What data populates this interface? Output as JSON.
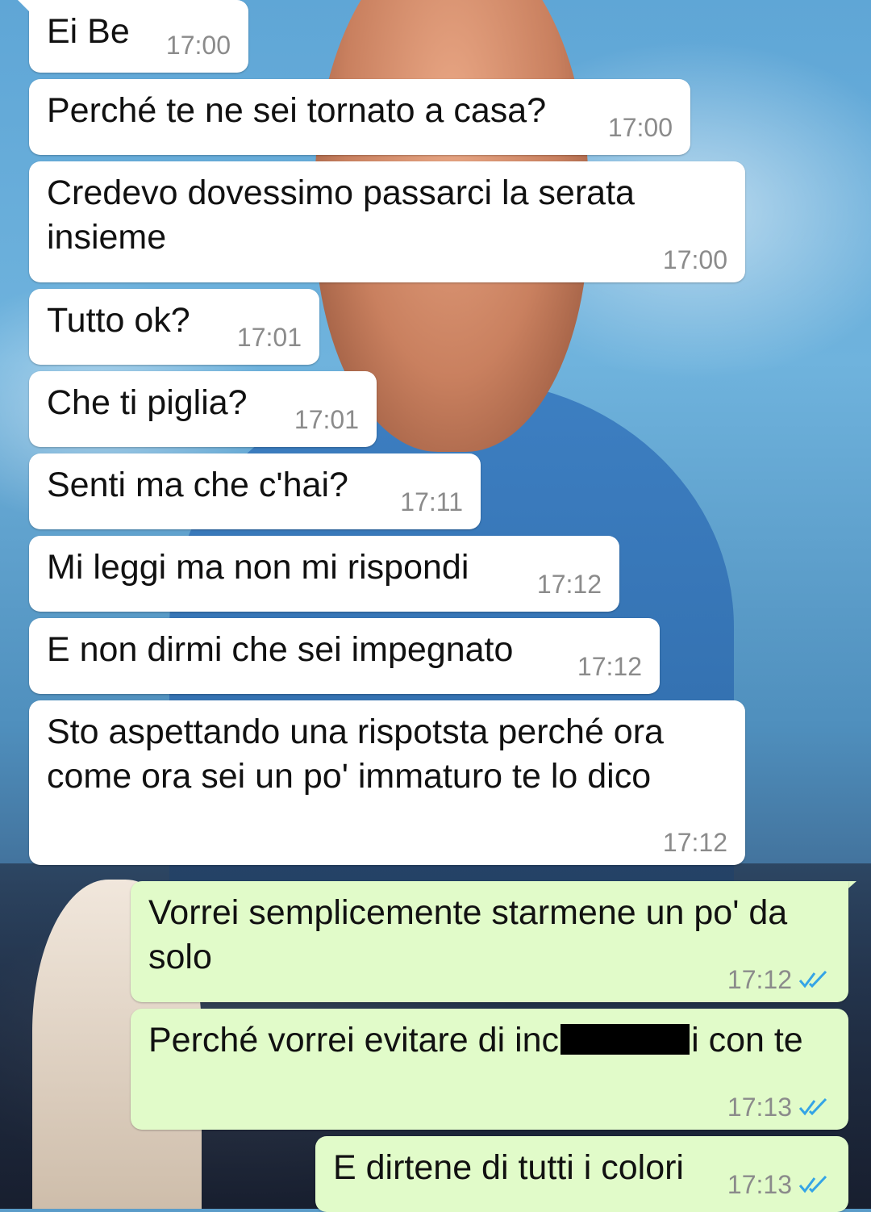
{
  "colors": {
    "incoming_bubble": "#ffffff",
    "outgoing_bubble": "#e1fbc9",
    "timestamp": "#8b8b8b",
    "read_tick": "#34a4e6"
  },
  "messages": [
    {
      "direction": "in",
      "text": "Ei Be",
      "time": "17:00"
    },
    {
      "direction": "in",
      "text": "Perché te ne sei tornato a casa?",
      "time": "17:00"
    },
    {
      "direction": "in",
      "text": "Credevo dovessimo passarci la serata insieme",
      "time": "17:00"
    },
    {
      "direction": "in",
      "text": "Tutto ok?",
      "time": "17:01"
    },
    {
      "direction": "in",
      "text": "Che ti piglia?",
      "time": "17:01"
    },
    {
      "direction": "in",
      "text": "Senti ma che c'hai?",
      "time": "17:11"
    },
    {
      "direction": "in",
      "text": "Mi leggi ma non mi rispondi",
      "time": "17:12"
    },
    {
      "direction": "in",
      "text": "E non dirmi che sei impegnato",
      "time": "17:12"
    },
    {
      "direction": "in",
      "text": "Sto aspettando una rispotsta perché ora come ora sei un po' immaturo te lo dico",
      "time": "17:12"
    },
    {
      "direction": "out",
      "text": "Vorrei semplicemente starmene un po' da solo",
      "time": "17:12",
      "status_icon": "double-check-read-icon"
    },
    {
      "direction": "out",
      "text_before": "Perché vorrei evitare di inc",
      "text_after": "i con te",
      "redacted": true,
      "time": "17:13",
      "status_icon": "double-check-read-icon"
    },
    {
      "direction": "out",
      "text": "E dirtene di tutti i colori",
      "time": "17:13",
      "status_icon": "double-check-read-icon"
    }
  ]
}
